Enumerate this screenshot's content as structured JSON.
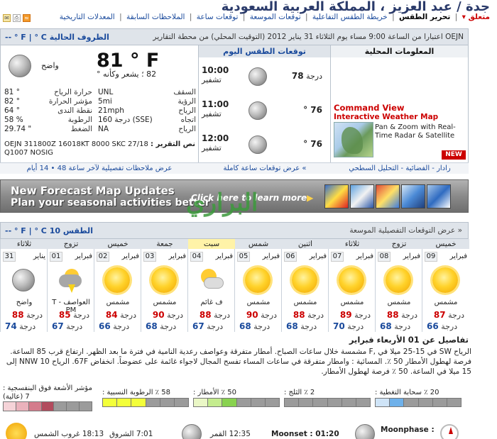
{
  "header": {
    "title": "جدة / عبد العزيز ، المملكة العربية السعودية",
    "nav": [
      "متعلق",
      "تحرير الطقس",
      "خريطة الطقس التفاعلية",
      "توقعات الموسعة",
      "توقعات ساعة",
      "الملاحظات السابقة",
      "المعدلات التاريخية"
    ],
    "current_nav": "تحرير الطقس",
    "fly_label": "متعلق ▾"
  },
  "conditions": {
    "heading": "الظروف الحالية",
    "unit_toggle": "-- ° F | ° C",
    "observed_note": "OEJN اعتبارا من الساعة 9:00 مساء يوم الثلاثاء 31 يناير 2012 (التوقيت المحلي) من محطة التقارير",
    "weather_text": "واضح",
    "temperature": "81 ° F",
    "feels_like": "82 ؛ يشعر وكأنه °",
    "left_stats": [
      {
        "k": "حرارة الرياح",
        "v": "81 °"
      },
      {
        "k": "مؤشر الحرارة",
        "v": "82 °"
      },
      {
        "k": "نقطة الندى",
        "v": "64 °"
      },
      {
        "k": "الرطوبة",
        "v": "58 %"
      },
      {
        "k": "الضغط",
        "v": "29.74 \""
      }
    ],
    "right_stats": [
      {
        "k": "السقف",
        "v": "UNL"
      },
      {
        "k": "الرؤية",
        "v": "5mi"
      },
      {
        "k": "الرياح",
        "v": "21mph"
      },
      {
        "k": "اتجاه",
        "v": "160 درجة (SSE)"
      },
      {
        "k": "الرياح",
        "v": "NA"
      }
    ],
    "report_label": "نص التقرير :",
    "report_text": "OEJN 311800Z 16018KT 8000 SKC 27/18 Q1007 NOSIG",
    "footer_link": "عرض ملاحظات تفصيلية لآخر ساعة 48 • 14 أيام"
  },
  "hourly": {
    "heading": "توقعات الطقس اليوم",
    "items": [
      {
        "time": "10:00",
        "cond": "تشفير",
        "temp_label": "درجة",
        "temp": "78"
      },
      {
        "time": "11:00",
        "cond": "تشفير",
        "temp_label": "",
        "temp": "76 °"
      },
      {
        "time": "12:00",
        "cond": "تشفير",
        "temp_label": "",
        "temp": "76 °"
      }
    ],
    "footer_link": "» عرض توقعات ساعة كاملة"
  },
  "local": {
    "heading": "المعلومات المحلية",
    "cmd_title": "Command View",
    "cmd_subtitle": "Interactive Weather Map",
    "cmd_desc": "Pan & Zoom with Real-Time Radar & Satellite",
    "new_badge": "NEW",
    "footer_link": "رادار - الفضائية - التحليل السطحي"
  },
  "banner": {
    "line1": "New Forecast Map Updates",
    "line2": "Plan your seasonal activities better",
    "cta": "Click here to learn more",
    "watermark": "البراري"
  },
  "ten_day": {
    "heading": "الطقس 10",
    "unit_toggle": "-- ° F | ° C",
    "link": "« عرض التوقعات التفصيلية الموسعة",
    "days": [
      {
        "name": "خميس",
        "month": "فبراير",
        "date": "09",
        "icon": "sun",
        "cond": "مشمس",
        "hi": "87",
        "lo": "66"
      },
      {
        "name": "تزوج",
        "month": "فبراير",
        "date": "08",
        "icon": "sun",
        "cond": "مشمس",
        "hi": "88",
        "lo": "68"
      },
      {
        "name": "ثلاثاء",
        "month": "فبراير",
        "date": "07",
        "icon": "sun",
        "cond": "مشمس",
        "hi": "89",
        "lo": "70"
      },
      {
        "name": "اثنين",
        "month": "فبراير",
        "date": "06",
        "icon": "sun",
        "cond": "مشمس",
        "hi": "88",
        "lo": "68"
      },
      {
        "name": "شمس",
        "month": "فبراير",
        "date": "05",
        "icon": "sun",
        "cond": "مشمس",
        "hi": "90",
        "lo": "68"
      },
      {
        "name": "سبت",
        "month": "فبراير",
        "date": "04",
        "icon": "pcloud",
        "cond": "ف غائم",
        "hi": "88",
        "lo": "67"
      },
      {
        "name": "جمعة",
        "month": "فبراير",
        "date": "03",
        "icon": "sun",
        "cond": "مشمس",
        "hi": "90",
        "lo": "68"
      },
      {
        "name": "خميس",
        "month": "فبراير",
        "date": "02",
        "icon": "sun",
        "cond": "مشمس",
        "hi": "84",
        "lo": "66"
      },
      {
        "name": "تزوج",
        "month": "فبراير",
        "date": "01",
        "icon": "tstorm",
        "cond": "T - العواصف PM",
        "hi": "85",
        "lo": "67"
      },
      {
        "name": "ثلاثاء",
        "month": "يناير",
        "date": "31",
        "icon": "moon",
        "cond": "واضح",
        "hi": "88",
        "lo": "74"
      }
    ]
  },
  "details": {
    "heading": "تفاصيل عن 01 الأربعاء فبراير",
    "text": "الرياح SW في 15-25 ميلا في ,F مشمسة خلال ساعات الصباح. أمطار متفرقة وعواصف رعدية النامية في فترة ما بعد الظهر. ارتفاع قرب 85 الساعة. فرصة لهطول الأمطار 50 ٪. المسائية : وامطار متفرقة في ساعات المساء تفسح المجال لاجواء غائمة على عضوضاً. انخفاض 67F. الرياح NNW 10 إلى 15 ميلا في الساعة. 50 ٪ فرصة لهطول الأمطار."
  },
  "indices": {
    "uv_label": "مؤشر الأشعة فوق البنفسجية : 7 (عالية)",
    "humidity": {
      "label": "٪ الرطوبة النسبية :",
      "value": "58"
    },
    "precip": {
      "label": "٪ الأمطار :",
      "value": "50"
    },
    "snow": {
      "label": "٪ الثلج :",
      "value": "2"
    },
    "cloud": {
      "label": "٪ سحابة التغطية :",
      "value": "20"
    }
  },
  "astro": {
    "sunrise": "7:01 الشروق",
    "sunset": "18:13 غروب الشمس",
    "moonrise": "12:35 القمر",
    "moonset": "Moonset : 01:20",
    "moonphase": "Moonphase :"
  }
}
